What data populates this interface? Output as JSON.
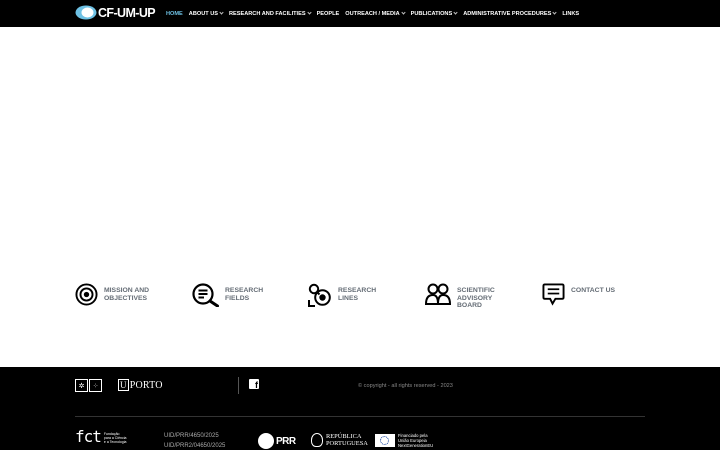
{
  "header": {
    "logo_text": "CF-UM-UP",
    "nav": [
      {
        "label": "HOME",
        "active": true,
        "dropdown": false
      },
      {
        "label": "ABOUT US",
        "active": false,
        "dropdown": true
      },
      {
        "label": "RESEARCH AND FACILITIES",
        "active": false,
        "dropdown": true
      },
      {
        "label": "PEOPLE",
        "active": false,
        "dropdown": false
      },
      {
        "label": "OUTREACH / MEDIA",
        "active": false,
        "dropdown": true
      },
      {
        "label": "PUBLICATIONS",
        "active": false,
        "dropdown": true
      },
      {
        "label": "ADMINISTRATIVE PROCEDURES",
        "active": false,
        "dropdown": true
      },
      {
        "label": "LINKS",
        "active": false,
        "dropdown": false
      }
    ]
  },
  "features": [
    {
      "icon": "target-icon",
      "line1": "MISSION AND",
      "line2": "OBJECTIVES",
      "line3": ""
    },
    {
      "icon": "magnifier-list-icon",
      "line1": "RESEARCH",
      "line2": "FIELDS",
      "line3": ""
    },
    {
      "icon": "research-lines-icon",
      "line1": "RESEARCH",
      "line2": "LINES",
      "line3": ""
    },
    {
      "icon": "group-icon",
      "line1": "SCIENTIFIC",
      "line2": "ADVISORY",
      "line3": "BOARD"
    },
    {
      "icon": "chat-bubble-icon",
      "line1": "CONTACT US",
      "line2": "",
      "line3": ""
    }
  ],
  "footer": {
    "uporto_u": "U",
    "uporto_text": "PORTO",
    "facebook_glyph": "f",
    "copyright": "© copyright - all rights reserved - 2023",
    "fct_big": "fct",
    "fct_small_1": "Fundação",
    "fct_small_2": "para a Ciência",
    "fct_small_3": "e a Tecnologia",
    "uid_1": "UID/PRR/4650/2025",
    "uid_2": "UID/PRR2/04650/2025",
    "prr_text": "PRR",
    "republica_1": "REPÚBLICA",
    "republica_2": "PORTUGUESA",
    "eu_1": "Financiado pela",
    "eu_2": "União Europeia",
    "eu_3": "NextGenerationEU"
  },
  "colors": {
    "header_bg": "#000000",
    "active_nav": "#6ec1e4",
    "feature_text": "#646c75",
    "footer_bg": "#000000"
  }
}
